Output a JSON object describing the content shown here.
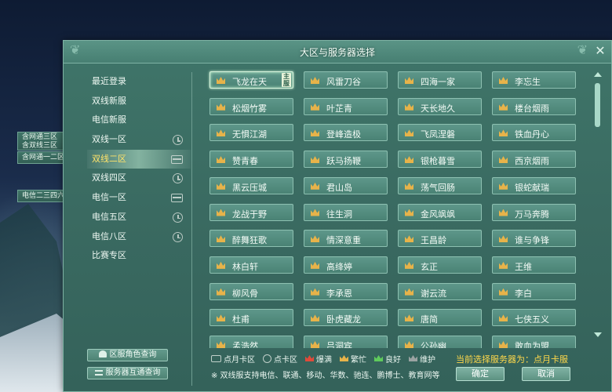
{
  "dialog": {
    "title": "大区与服务器选择",
    "close": "✕"
  },
  "sidebar": {
    "items": [
      {
        "label": "最近登录",
        "icon": ""
      },
      {
        "label": "双线新服",
        "icon": ""
      },
      {
        "label": "电信新服",
        "icon": ""
      },
      {
        "label": "双线一区",
        "icon": "clock"
      },
      {
        "label": "双线二区",
        "icon": "card",
        "active": true
      },
      {
        "label": "双线四区",
        "icon": "clock"
      },
      {
        "label": "电信一区",
        "icon": "card"
      },
      {
        "label": "电信五区",
        "icon": "clock"
      },
      {
        "label": "电信八区",
        "icon": "clock"
      },
      {
        "label": "比赛专区",
        "icon": ""
      }
    ]
  },
  "side_tags": [
    {
      "line1": "含网通三区",
      "line2": "含双线三区",
      "close": "✕"
    },
    {
      "line1": "含网通一二区",
      "line2": "",
      "close": "✕"
    },
    {
      "line1": "电信二三四六七区",
      "line2": "",
      "close": "✕"
    }
  ],
  "servers": [
    {
      "name": "飞龙在天",
      "status": "yellow",
      "selected": true,
      "tag": "主服"
    },
    {
      "name": "风雷刀谷",
      "status": "yellow"
    },
    {
      "name": "四海一家",
      "status": "yellow"
    },
    {
      "name": "李忘生",
      "status": "yellow"
    },
    {
      "name": "松烟竹雾",
      "status": "yellow"
    },
    {
      "name": "叶芷青",
      "status": "yellow"
    },
    {
      "name": "天长地久",
      "status": "yellow"
    },
    {
      "name": "楼台烟雨",
      "status": "yellow"
    },
    {
      "name": "无惧江湖",
      "status": "yellow"
    },
    {
      "name": "登峰造极",
      "status": "yellow"
    },
    {
      "name": "飞凤涅磐",
      "status": "yellow"
    },
    {
      "name": "铁血丹心",
      "status": "yellow"
    },
    {
      "name": "赞青春",
      "status": "yellow"
    },
    {
      "name": "跃马扬鞭",
      "status": "yellow"
    },
    {
      "name": "银枪暮雪",
      "status": "yellow"
    },
    {
      "name": "西京烟雨",
      "status": "yellow"
    },
    {
      "name": "黑云压城",
      "status": "yellow"
    },
    {
      "name": "君山岛",
      "status": "yellow"
    },
    {
      "name": "荡气回肠",
      "status": "yellow"
    },
    {
      "name": "银蛇献瑞",
      "status": "yellow"
    },
    {
      "name": "龙战于野",
      "status": "yellow"
    },
    {
      "name": "往生洞",
      "status": "yellow"
    },
    {
      "name": "金风飒飒",
      "status": "yellow"
    },
    {
      "name": "万马奔腾",
      "status": "yellow"
    },
    {
      "name": "醉舞狂歌",
      "status": "yellow"
    },
    {
      "name": "情深意重",
      "status": "yellow"
    },
    {
      "name": "王昌龄",
      "status": "yellow"
    },
    {
      "name": "谁与争锋",
      "status": "yellow"
    },
    {
      "name": "林白轩",
      "status": "yellow"
    },
    {
      "name": "高绛婷",
      "status": "yellow"
    },
    {
      "name": "玄正",
      "status": "yellow"
    },
    {
      "name": "王维",
      "status": "yellow"
    },
    {
      "name": "柳风骨",
      "status": "yellow"
    },
    {
      "name": "李承恩",
      "status": "yellow"
    },
    {
      "name": "谢云流",
      "status": "yellow"
    },
    {
      "name": "李白",
      "status": "yellow"
    },
    {
      "name": "杜甫",
      "status": "yellow"
    },
    {
      "name": "卧虎藏龙",
      "status": "yellow"
    },
    {
      "name": "唐简",
      "status": "yellow"
    },
    {
      "name": "七侠五义",
      "status": "yellow"
    },
    {
      "name": "孟浩然",
      "status": "yellow"
    },
    {
      "name": "吕洞宾",
      "status": "yellow"
    },
    {
      "name": "公孙幽",
      "status": "yellow"
    },
    {
      "name": "敢血为盟",
      "status": "yellow"
    }
  ],
  "legend": {
    "card": "点月卡区",
    "clock": "点卡区",
    "full": "爆满",
    "busy": "繁忙",
    "good": "良好",
    "maintain": "维护"
  },
  "current": "当前选择服务器为：点月卡服",
  "note": "※ 双线服支持电信、联通、移动、华数、驰连、鹏博士、教育网等",
  "buttons": {
    "confirm": "确定",
    "cancel": "取消"
  },
  "bottom_buttons": {
    "role_query": "区服角色查询",
    "interop_query": "服务器互通查询"
  },
  "colors": {
    "full": "#e04a3a",
    "busy": "#e7b34a",
    "good": "#5fca5c",
    "maintain": "#9aa3a2",
    "current": "#ffd84a"
  }
}
